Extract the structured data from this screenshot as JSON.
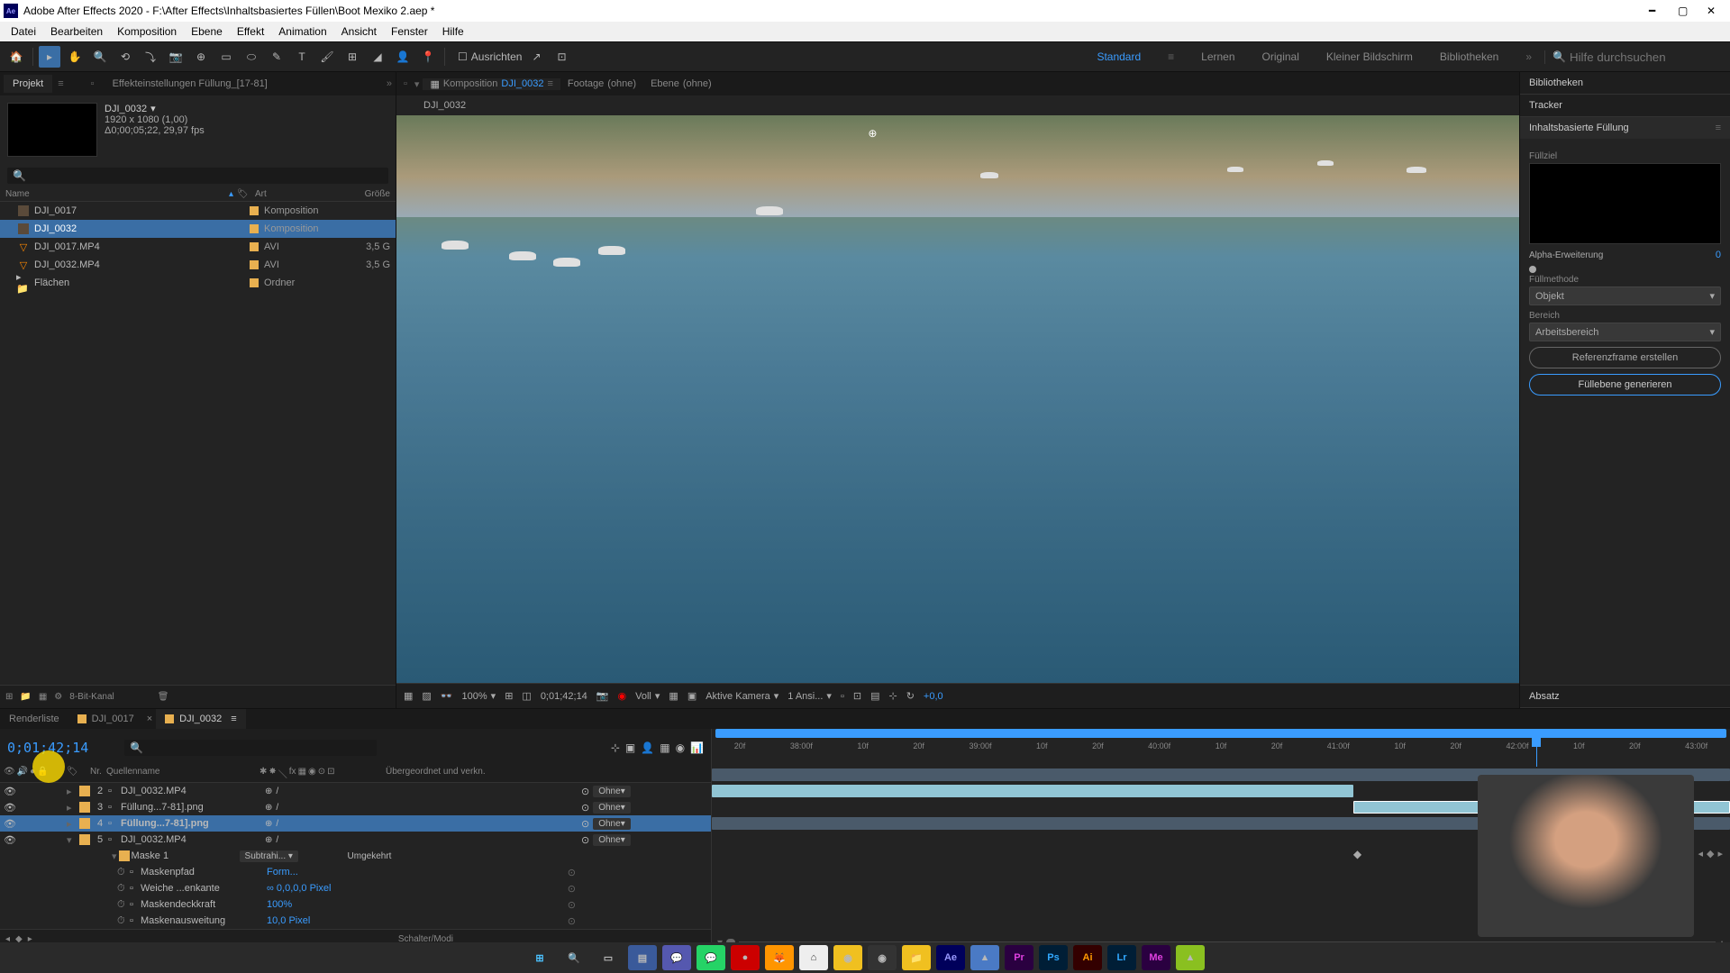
{
  "title": "Adobe After Effects 2020 - F:\\After Effects\\Inhaltsbasiertes Füllen\\Boot Mexiko 2.aep *",
  "menu": [
    "Datei",
    "Bearbeiten",
    "Komposition",
    "Ebene",
    "Effekt",
    "Animation",
    "Ansicht",
    "Fenster",
    "Hilfe"
  ],
  "toolbar": {
    "align": "Ausrichten",
    "workspaces": [
      "Standard",
      "Lernen",
      "Original",
      "Kleiner Bildschirm",
      "Bibliotheken"
    ],
    "search_placeholder": "Hilfe durchsuchen"
  },
  "left_panel": {
    "project_tab": "Projekt",
    "effect_tab": "Effekteinstellungen Füllung_[17-81]",
    "comp_name": "DJI_0032",
    "comp_res": "1920 x 1080 (1,00)",
    "comp_dur": "Δ0;00;05;22, 29,97 fps",
    "columns": {
      "name": "Name",
      "art": "Art",
      "size": "Größe"
    },
    "items": [
      {
        "name": "DJI_0017",
        "type": "Komposition",
        "size": "",
        "kind": "comp"
      },
      {
        "name": "DJI_0032",
        "type": "Komposition",
        "size": "",
        "kind": "comp",
        "selected": true
      },
      {
        "name": "DJI_0017.MP4",
        "type": "AVI",
        "size": "3,5 G",
        "kind": "mp4"
      },
      {
        "name": "DJI_0032.MP4",
        "type": "AVI",
        "size": "3,5 G",
        "kind": "mp4"
      },
      {
        "name": "Flächen",
        "type": "Ordner",
        "size": "",
        "kind": "folder"
      }
    ],
    "footer_depth": "8-Bit-Kanal"
  },
  "viewer": {
    "tabs": {
      "comp_label": "Komposition",
      "comp_value": "DJI_0032",
      "footage_label": "Footage",
      "footage_value": "(ohne)",
      "layer_label": "Ebene",
      "layer_value": "(ohne)"
    },
    "breadcrumb": "DJI_0032",
    "footer": {
      "zoom": "100%",
      "timecode": "0;01;42;14",
      "quality": "Voll",
      "camera": "Aktive Kamera",
      "view": "1 Ansi...",
      "exposure": "+0,0"
    }
  },
  "right_panel": {
    "bibliotheken": "Bibliotheken",
    "tracker": "Tracker",
    "caf_title": "Inhaltsbasierte Füllung",
    "fill_target": "Füllziel",
    "alpha_exp": "Alpha-Erweiterung",
    "alpha_val": "0",
    "method": "Füllmethode",
    "method_val": "Objekt",
    "range": "Bereich",
    "range_val": "Arbeitsbereich",
    "ref_button": "Referenzframe erstellen",
    "gen_button": "Füllebene generieren",
    "absatz": "Absatz"
  },
  "timeline": {
    "tabs": {
      "render": "Renderliste",
      "c1": "DJI_0017",
      "c2": "DJI_0032"
    },
    "timecode": "0;01;42;14",
    "col_nr": "Nr.",
    "col_source": "Quellenname",
    "col_parent": "Übergeordnet und verkn.",
    "layers": [
      {
        "num": "2",
        "name": "DJI_0032.MP4",
        "color": "#e8b050",
        "mode": "Ohne",
        "partial": true
      },
      {
        "num": "3",
        "name": "Füllung...7-81].png",
        "color": "#e8b050",
        "mode": "Ohne"
      },
      {
        "num": "4",
        "name": "Füllung...7-81].png",
        "color": "#e8b050",
        "mode": "Ohne",
        "selected": true
      },
      {
        "num": "5",
        "name": "DJI_0032.MP4",
        "color": "#e8b050",
        "mode": "Ohne",
        "expanded": true
      }
    ],
    "mask": {
      "name": "Maske 1",
      "mode": "Subtrahi...",
      "invert": "Umgekehrt",
      "props": [
        {
          "name": "Maskenpfad",
          "value": "Form..."
        },
        {
          "name": "Weiche ...enkante",
          "value": "∞ 0,0,0,0 Pixel"
        },
        {
          "name": "Maskendeckkraft",
          "value": "100%"
        },
        {
          "name": "Maskenausweitung",
          "value": "10,0 Pixel"
        }
      ]
    },
    "ruler_ticks": [
      "20f",
      "38:00f",
      "10f",
      "20f",
      "39:00f",
      "10f",
      "20f",
      "40:00f",
      "10f",
      "20f",
      "41:00f",
      "10f",
      "20f",
      "42:00f",
      "10f",
      "20f",
      "43:00f"
    ],
    "footer": "Schalter/Modi"
  }
}
